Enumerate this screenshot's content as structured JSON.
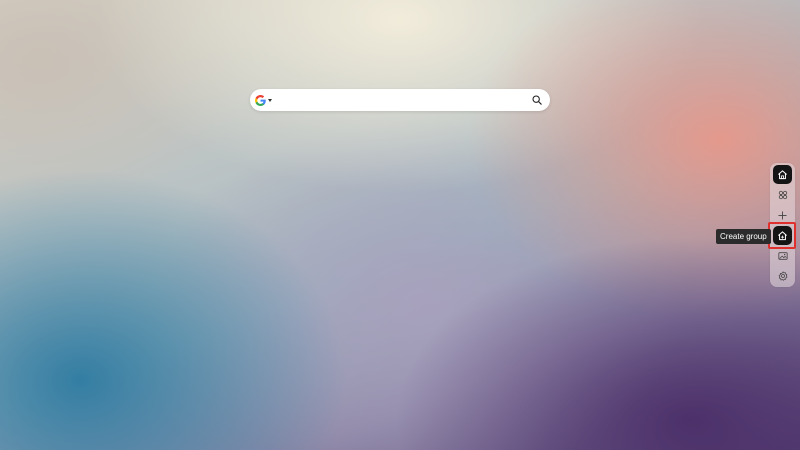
{
  "search": {
    "engine_icon": "google-logo-icon",
    "value": "",
    "placeholder": "",
    "submit_icon": "search-icon"
  },
  "sidebar": {
    "items": [
      {
        "name": "home",
        "icon": "home-icon",
        "active": true
      },
      {
        "name": "apps",
        "icon": "apps-icon",
        "active": false
      },
      {
        "name": "add",
        "icon": "plus-icon",
        "active": false
      },
      {
        "name": "create-group",
        "icon": "create-group-icon",
        "active": true,
        "highlighted": true
      },
      {
        "name": "wallpaper",
        "icon": "image-icon",
        "active": false
      },
      {
        "name": "settings",
        "icon": "gear-icon",
        "active": false
      }
    ]
  },
  "tooltip": {
    "text": "Create group"
  },
  "colors": {
    "active_button": "#141414",
    "highlight": "#e0302d",
    "tooltip_bg": "#2b2b2b"
  }
}
